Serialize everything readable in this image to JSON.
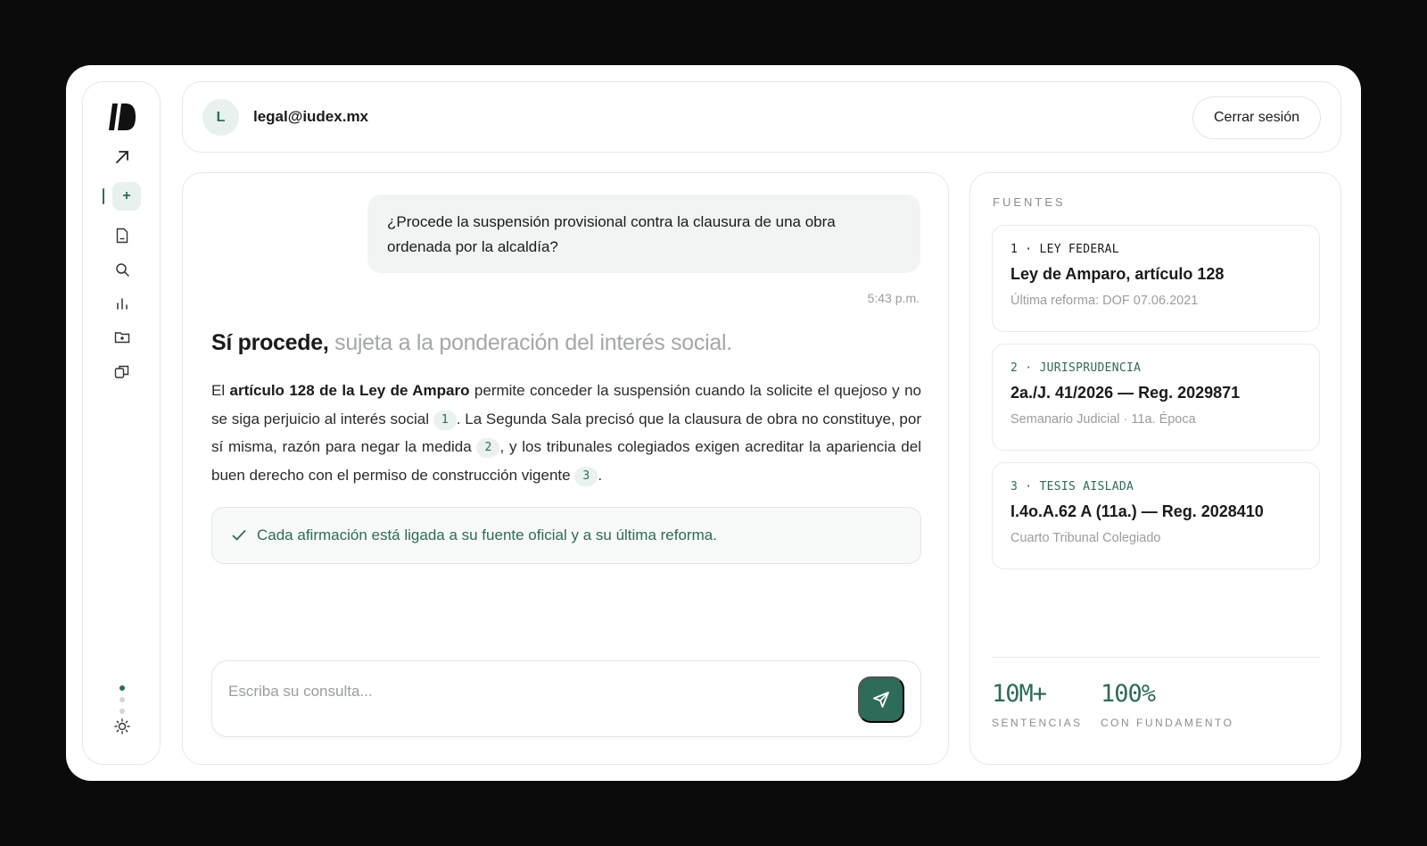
{
  "user": {
    "initial": "L",
    "email": "legal@iudex.mx",
    "logout_label": "Cerrar sesión"
  },
  "nav": [
    {
      "name": "arrow-up-right-icon"
    },
    {
      "name": "new-chat",
      "label": "+"
    },
    {
      "name": "document-icon"
    },
    {
      "name": "search-icon"
    },
    {
      "name": "chart-icon"
    },
    {
      "name": "folder-icon"
    },
    {
      "name": "copy-icon"
    }
  ],
  "chat": {
    "question": "¿Procede la suspensión provisional contra la clausura de una obra ordenada por la alcaldía?",
    "time": "5:43 p.m.",
    "answer_strong": "Sí procede,",
    "answer_muted": "sujeta a la ponderación del interés social.",
    "body": {
      "p1": "El ",
      "b1": "artículo 128 de la Ley de Amparo",
      "p2": " permite conceder la suspensión cuando la solicite el quejoso y no se siga perjuicio al interés social ",
      "c1": "1",
      "p3": ". La Segunda Sala precisó que la clausura de obra no constituye, por sí misma, razón para negar la medida ",
      "c2": "2",
      "p4": ", y los tribunales colegiados exigen acreditar la apariencia del buen derecho con el permiso de construcción vigente ",
      "c3": "3",
      "p5": "."
    },
    "verified_note": "Cada afirmación está ligada a su fuente oficial y a su última reforma.",
    "input_placeholder": "Escriba su consulta..."
  },
  "sources": {
    "title": "FUENTES",
    "items": [
      {
        "kind": "1 · LEY FEDERAL",
        "title": "Ley de Amparo, artículo 128",
        "meta": "Última reforma: DOF 07.06.2021"
      },
      {
        "kind": "2 · JURISPRUDENCIA",
        "title": "2a./J. 41/2026 — Reg. 2029871",
        "meta": "Semanario Judicial · 11a. Época"
      },
      {
        "kind": "3 · TESIS AISLADA",
        "title": "I.4o.A.62 A (11a.) — Reg. 2028410",
        "meta": "Cuarto Tribunal Colegiado"
      }
    ],
    "stats": [
      {
        "value": "10M+",
        "label": "SENTENCIAS"
      },
      {
        "value": "100%",
        "label": "CON FUNDAMENTO"
      }
    ]
  },
  "colors": {
    "accent": "#2f6b5a",
    "accent_soft": "#e8f1ee",
    "background": "#0b0b0b"
  }
}
